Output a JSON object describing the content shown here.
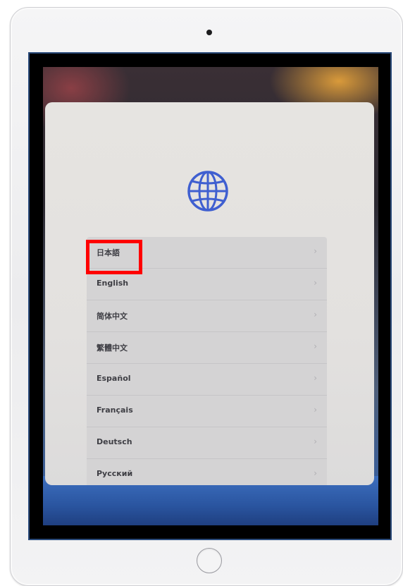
{
  "setup_screen": {
    "languages": [
      {
        "label": "日本語"
      },
      {
        "label": "English"
      },
      {
        "label": "简体中文"
      },
      {
        "label": "繁體中文"
      },
      {
        "label": "Español"
      },
      {
        "label": "Français"
      },
      {
        "label": "Deutsch"
      },
      {
        "label": "Русский"
      }
    ],
    "chevron": "›",
    "highlighted_language": "日本語"
  },
  "colors": {
    "highlight_border": "#ff0000",
    "globe": "#3f5fd0",
    "sheet_background": "#e4e2df"
  },
  "icons": [
    "globe-icon",
    "chevron-right-icon",
    "camera",
    "home-button"
  ]
}
